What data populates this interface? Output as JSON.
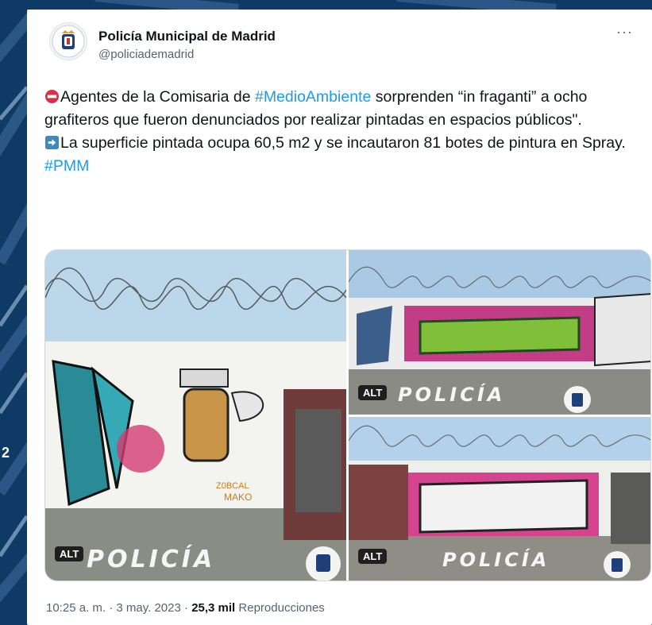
{
  "background": {
    "side_text": "2"
  },
  "account": {
    "display_name": "Policía Municipal de Madrid",
    "handle": "@policiademadrid"
  },
  "tweet": {
    "line1_text": "Agentes de la Comisaria de ",
    "line1_hashtag": "#MedioAmbiente",
    "line1_rest": " sorprenden “in fraganti” a ocho grafiteros que fueron denunciados por realizar pintadas en espacios públicos\".",
    "line2_text": "La superficie pintada ocupa 60,5 m2 y se incautaron 81 botes de pintura en Spray.",
    "hashtag2": "#PMM",
    "emoji1": "no-entry-icon",
    "emoji2": "right-arrow-icon"
  },
  "media": {
    "alt_label": "ALT",
    "watermark": "POLICÍA",
    "photo1_tags": [
      "MAKO",
      "Z0BCAL"
    ]
  },
  "meta": {
    "time": "10:25 a. m.",
    "sep1": " · ",
    "date": "3 may. 2023",
    "sep2": " · ",
    "views_count": "25,3 mil",
    "views_label": " Reproducciones"
  },
  "colors": {
    "link": "#1d9bf0",
    "text": "#0f1419",
    "secondary": "#536471",
    "background": "#0f3a66"
  }
}
